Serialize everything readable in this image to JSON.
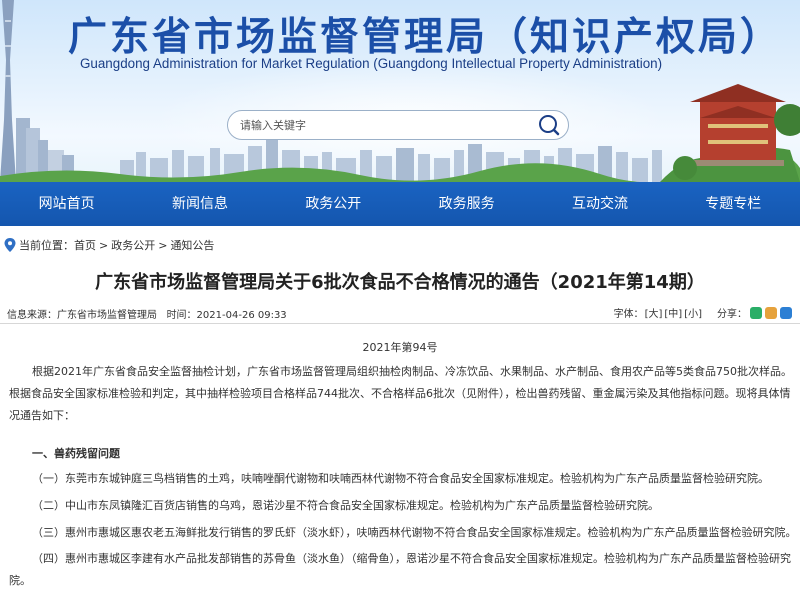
{
  "header": {
    "title_cn": "广东省市场监督管理局（知识产权局）",
    "title_en": "Guangdong Administration for Market Regulation (Guangdong Intellectual Property Administration)"
  },
  "search": {
    "placeholder": "请输入关键字"
  },
  "nav": {
    "items": [
      "网站首页",
      "新闻信息",
      "政务公开",
      "政务服务",
      "互动交流",
      "专题专栏"
    ]
  },
  "breadcrumb": {
    "label": "当前位置：",
    "items": [
      "首页",
      "政务公开",
      "通知公告"
    ],
    "separator": ">"
  },
  "article": {
    "title": "广东省市场监督管理局关于6批次食品不合格情况的通告（2021年第14期）",
    "source": "信息来源：广东省市场监督管理局",
    "time": "时间：2021-04-26 09:33",
    "font_label": "字体：",
    "font_sizes": [
      "[大]",
      "[中]",
      "[小]"
    ],
    "share_label": "分享：",
    "doc_no": "2021年第94号",
    "intro": "根据2021年广东省食品安全监督抽检计划，广东省市场监督管理局组织抽检肉制品、冷冻饮品、水果制品、水产制品、食用农产品等5类食品750批次样品。根据食品安全国家标准检验和判定，其中抽样检验项目合格样品744批次、不合格样品6批次（见附件），检出兽药残留、重金属污染及其他指标问题。现将具体情况通告如下：",
    "section1": "一、兽药残留问题",
    "items": [
      "（一）东莞市东城钟庭三鸟档销售的土鸡，呋喃唑酮代谢物和呋喃西林代谢物不符合食品安全国家标准规定。检验机构为广东产品质量监督检验研究院。",
      "（二）中山市东凤镇隆汇百货店销售的乌鸡，恩诺沙星不符合食品安全国家标准规定。检验机构为广东产品质量监督检验研究院。",
      "（三）惠州市惠城区惠农老五海鲜批发行销售的罗氏虾（淡水虾），呋喃西林代谢物不符合食品安全国家标准规定。检验机构为广东产品质量监督检验研究院。",
      "（四）惠州市惠城区李建有水产品批发部销售的苏骨鱼（淡水鱼）（缩骨鱼），恩诺沙星不符合食品安全国家标准规定。检验机构为广东产品质量监督检验研究院。"
    ]
  },
  "colors": {
    "nav_bg": "#1a63c2",
    "title_blue": "#1b4fa8",
    "share_wechat": "#2aae67",
    "share_weibo": "#e6a23c",
    "share_qzone": "#2c7fd4"
  }
}
